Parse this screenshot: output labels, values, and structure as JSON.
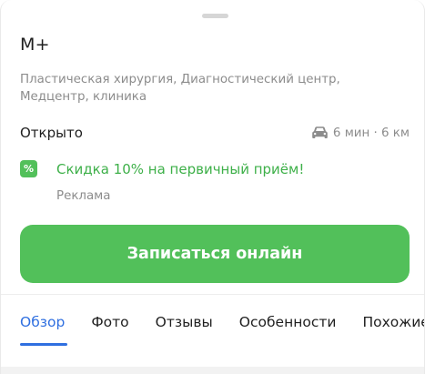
{
  "place": {
    "name": "М+",
    "categories": "Пластическая хирургия, Диагностический центр, Медцентр, клиника",
    "status": "Открыто",
    "travel": "6 мин · 6 км",
    "travel_icon": "car-icon"
  },
  "promo": {
    "icon": "discount-icon",
    "icon_glyph": "%",
    "text": "Скидка 10% на первичный приём!",
    "ad_label": "Реклама",
    "color": "#52c05a"
  },
  "cta": {
    "label": "Записаться онлайн",
    "color": "#52c05a"
  },
  "tabs": {
    "items": [
      {
        "label": "Обзор",
        "active": true
      },
      {
        "label": "Фото",
        "active": false
      },
      {
        "label": "Отзывы",
        "active": false
      },
      {
        "label": "Особенности",
        "active": false
      },
      {
        "label": "Похожие",
        "active": false
      }
    ],
    "active_color": "#2f6fe0"
  }
}
